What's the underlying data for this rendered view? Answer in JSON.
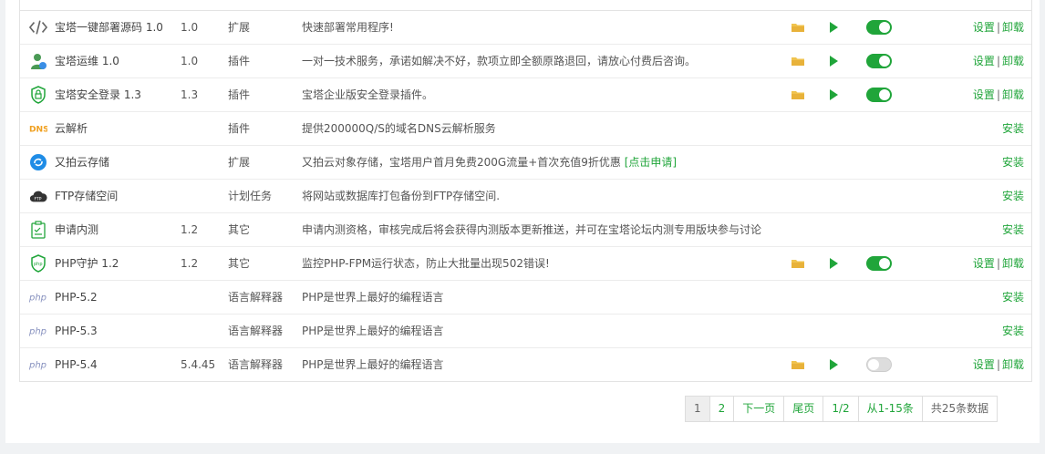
{
  "rows": [
    {
      "name": "宝塔一键部署源码 1.0",
      "ver": "1.0",
      "type": "扩展",
      "desc": "快速部署常用程序!",
      "link": "",
      "installed": true,
      "enabled": true,
      "icon": "code-icon"
    },
    {
      "name": "宝塔运维 1.0",
      "ver": "1.0",
      "type": "插件",
      "desc": "一对一技术服务，承诺如解决不好，款项立即全额原路退回，请放心付费后咨询。",
      "link": "",
      "installed": true,
      "enabled": true,
      "icon": "support-person-icon"
    },
    {
      "name": "宝塔安全登录 1.3",
      "ver": "1.3",
      "type": "插件",
      "desc": "宝塔企业版安全登录插件。",
      "link": "",
      "installed": true,
      "enabled": true,
      "icon": "shield-lock-icon"
    },
    {
      "name": "云解析",
      "ver": "",
      "type": "插件",
      "desc": "提供200000Q/S的域名DNS云解析服务",
      "link": "",
      "installed": false,
      "enabled": false,
      "icon": "dns-icon"
    },
    {
      "name": "又拍云存储",
      "ver": "",
      "type": "扩展",
      "desc": "又拍云对象存储，宝塔用户首月免费200G流量+首次充值9折优惠 ",
      "link": "[点击申请]",
      "installed": false,
      "enabled": false,
      "icon": "upyun-icon"
    },
    {
      "name": "FTP存储空间",
      "ver": "",
      "type": "计划任务",
      "desc": "将网站或数据库打包备份到FTP存储空间.",
      "link": "",
      "installed": false,
      "enabled": false,
      "icon": "ftp-cloud-icon"
    },
    {
      "name": "申请内测",
      "ver": "1.2",
      "type": "其它",
      "desc": "申请内测资格，审核完成后将会获得内测版本更新推送，并可在宝塔论坛内测专用版块参与讨论",
      "link": "",
      "installed": false,
      "enabled": false,
      "icon": "clipboard-icon"
    },
    {
      "name": "PHP守护 1.2",
      "ver": "1.2",
      "type": "其它",
      "desc": "监控PHP-FPM运行状态，防止大批量出现502错误!",
      "link": "",
      "installed": true,
      "enabled": true,
      "icon": "php-shield-icon"
    },
    {
      "name": "PHP-5.2",
      "ver": "",
      "type": "语言解释器",
      "desc": "PHP是世界上最好的编程语言",
      "link": "",
      "installed": false,
      "enabled": false,
      "icon": "php-icon"
    },
    {
      "name": "PHP-5.3",
      "ver": "",
      "type": "语言解释器",
      "desc": "PHP是世界上最好的编程语言",
      "link": "",
      "installed": false,
      "enabled": false,
      "icon": "php-icon"
    },
    {
      "name": "PHP-5.4",
      "ver": "5.4.45",
      "type": "语言解释器",
      "desc": "PHP是世界上最好的编程语言",
      "link": "",
      "installed": true,
      "enabled": false,
      "icon": "php-icon"
    }
  ],
  "labels": {
    "settings": "设置",
    "uninstall": "卸载",
    "separator": "|",
    "install": "安装",
    "dns_text": "DNS",
    "php_text": "php",
    "ftp_text": "FTP"
  },
  "pager": {
    "current": "1",
    "page2": "2",
    "next": "下一页",
    "last": "尾页",
    "ratio": "1/2",
    "range": "从1-15条",
    "total": "共25条数据"
  },
  "colors": {
    "accent": "#20a53a",
    "folder": "#f0c34e",
    "php": "#8892bf"
  }
}
